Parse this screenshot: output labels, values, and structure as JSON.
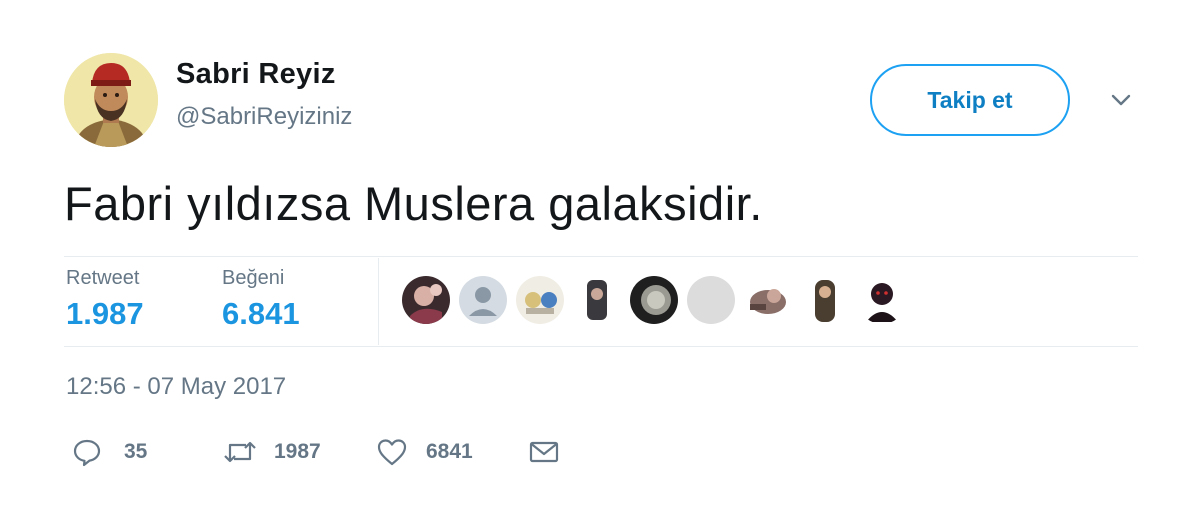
{
  "author": {
    "display_name": "Sabri Reyiz",
    "handle": "@SabriReyiziniz",
    "avatar_icon": "user-avatar"
  },
  "follow_button": {
    "label": "Takip et"
  },
  "menu": {
    "icon": "chevron-down-icon"
  },
  "tweet": {
    "text": "Fabri yıldızsa Muslera galaksidir.",
    "timestamp": "12:56 - 07 May 2017"
  },
  "stats": {
    "retweet_label": "Retweet",
    "retweet_value": "1.987",
    "like_label": "Beğeni",
    "like_value": "6.841"
  },
  "liker_count": 9,
  "actions": {
    "reply_count": "35",
    "retweet_count": "1987",
    "like_count": "6841"
  },
  "colors": {
    "accent": "#1da1f2",
    "stat_value": "#1b95e0",
    "muted": "#657786",
    "text": "#14171a",
    "divider": "#e6ecf0"
  }
}
